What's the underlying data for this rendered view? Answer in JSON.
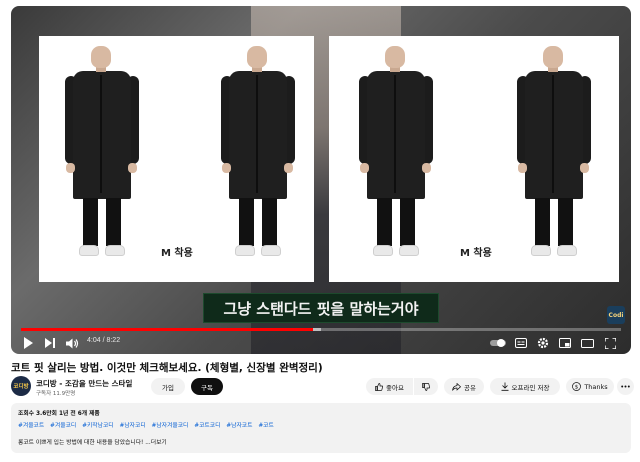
{
  "video": {
    "panel_left_tag": "M 착용",
    "panel_right_tag": "M 착용",
    "subtitle": "그냥 스탠다드 핏을 말하는거야",
    "channel_watermark": "Codi",
    "current_time": "4:04 / 8:22",
    "progress_fraction": 0.487,
    "buffered_fraction": 0.5
  },
  "title": "코트 핏 살리는 방법. 이것만 체크해보세요. (체형별, 신장별 완벽정리)",
  "channel": {
    "avatar_text": "코디방",
    "name": "코디방 - 조감을 만드는 스타일",
    "subscribers": "구독자 11.9만명",
    "join_label": "가입",
    "subscribe_label": "구독"
  },
  "actions": {
    "like_label": "좋아요",
    "share_label": "공유",
    "download_label": "오프라인 저장",
    "thanks_label": "Thanks"
  },
  "description": {
    "stats": "조회수 3.6만회  1년 전  6개 제품",
    "hashtags": [
      "#겨울코트",
      "#겨울코디",
      "#키작남코디",
      "#남자코디",
      "#남자겨울코디",
      "#코트코디",
      "#남자코트",
      "#코트"
    ],
    "body": "롱코트 이쁘게 입는 방법에 대한 내용을 담았습니다! ...더보기"
  },
  "colors": {
    "progress": "#ff0000",
    "subtitle_bg": "#0f2a1a",
    "link": "#065fd4",
    "avatar_bg": "#1c2b46"
  }
}
